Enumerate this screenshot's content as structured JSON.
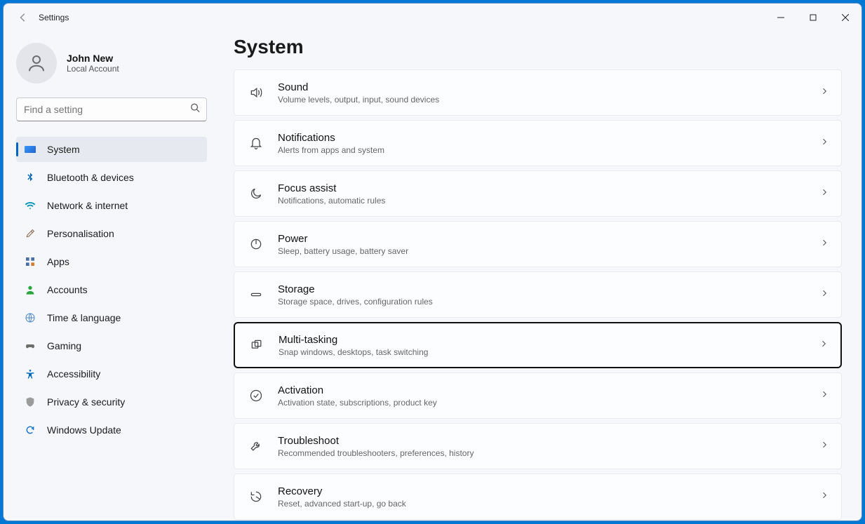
{
  "titlebar": {
    "title": "Settings"
  },
  "profile": {
    "name": "John New",
    "sub": "Local Account"
  },
  "search": {
    "placeholder": "Find a setting"
  },
  "nav": [
    {
      "id": "system",
      "label": "System",
      "active": true,
      "icon": "system"
    },
    {
      "id": "bluetooth",
      "label": "Bluetooth & devices",
      "icon": "bluetooth"
    },
    {
      "id": "network",
      "label": "Network & internet",
      "icon": "wifi"
    },
    {
      "id": "personalisation",
      "label": "Personalisation",
      "icon": "brush"
    },
    {
      "id": "apps",
      "label": "Apps",
      "icon": "apps"
    },
    {
      "id": "accounts",
      "label": "Accounts",
      "icon": "person"
    },
    {
      "id": "time",
      "label": "Time & language",
      "icon": "globe"
    },
    {
      "id": "gaming",
      "label": "Gaming",
      "icon": "gamepad"
    },
    {
      "id": "accessibility",
      "label": "Accessibility",
      "icon": "accessibility"
    },
    {
      "id": "privacy",
      "label": "Privacy & security",
      "icon": "shield"
    },
    {
      "id": "update",
      "label": "Windows Update",
      "icon": "update"
    }
  ],
  "page": {
    "title": "System"
  },
  "cards": [
    {
      "id": "sound",
      "title": "Sound",
      "sub": "Volume levels, output, input, sound devices",
      "icon": "sound"
    },
    {
      "id": "notifications",
      "title": "Notifications",
      "sub": "Alerts from apps and system",
      "icon": "bell"
    },
    {
      "id": "focus",
      "title": "Focus assist",
      "sub": "Notifications, automatic rules",
      "icon": "moon"
    },
    {
      "id": "power",
      "title": "Power",
      "sub": "Sleep, battery usage, battery saver",
      "icon": "power"
    },
    {
      "id": "storage",
      "title": "Storage",
      "sub": "Storage space, drives, configuration rules",
      "icon": "storage"
    },
    {
      "id": "multitasking",
      "title": "Multi-tasking",
      "sub": "Snap windows, desktops, task switching",
      "icon": "multitask",
      "focused": true
    },
    {
      "id": "activation",
      "title": "Activation",
      "sub": "Activation state, subscriptions, product key",
      "icon": "check"
    },
    {
      "id": "troubleshoot",
      "title": "Troubleshoot",
      "sub": "Recommended troubleshooters, preferences, history",
      "icon": "wrench"
    },
    {
      "id": "recovery",
      "title": "Recovery",
      "sub": "Reset, advanced start-up, go back",
      "icon": "recovery"
    }
  ]
}
